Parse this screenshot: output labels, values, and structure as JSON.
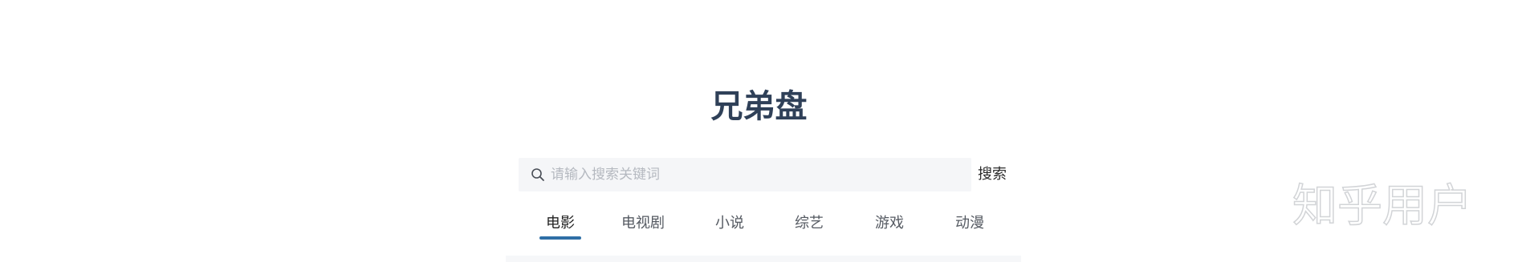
{
  "site": {
    "title": "兄弟盘"
  },
  "search": {
    "placeholder": "请输入搜索关键词",
    "value": "",
    "button_label": "搜索",
    "icon": "search-icon"
  },
  "tabs": [
    {
      "label": "电影",
      "active": true
    },
    {
      "label": "电视剧",
      "active": false
    },
    {
      "label": "小说",
      "active": false
    },
    {
      "label": "综艺",
      "active": false
    },
    {
      "label": "游戏",
      "active": false
    },
    {
      "label": "动漫",
      "active": false
    }
  ],
  "watermark": {
    "text": "知乎用户"
  },
  "colors": {
    "title": "#2f4058",
    "accent": "#2f6fa6",
    "search_bg": "#f5f6f8",
    "placeholder": "#b5b9c0"
  }
}
